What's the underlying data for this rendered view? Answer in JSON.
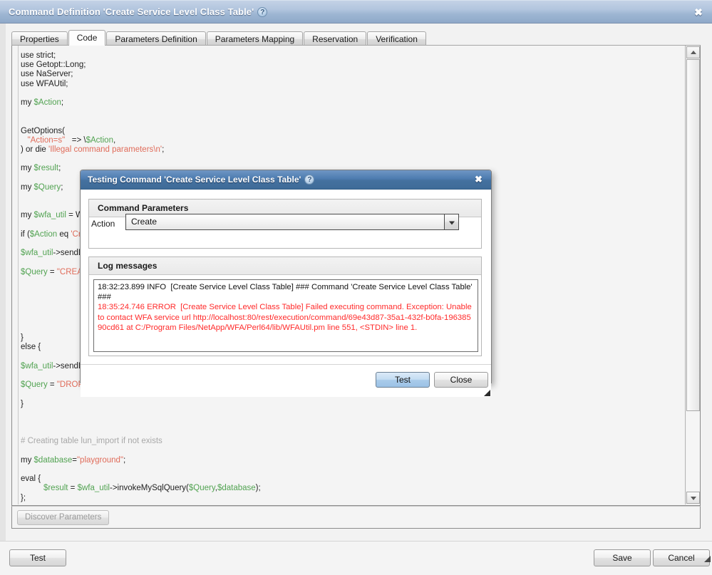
{
  "window": {
    "title": "Command Definition 'Create Service Level Class Table'",
    "help_icon_label": "?",
    "close_label": "✖"
  },
  "tabs": [
    {
      "label": "Properties",
      "active": false
    },
    {
      "label": "Code",
      "active": true
    },
    {
      "label": "Parameters Definition",
      "active": false
    },
    {
      "label": "Parameters Mapping",
      "active": false
    },
    {
      "label": "Reservation",
      "active": false
    },
    {
      "label": "Verification",
      "active": false
    }
  ],
  "code_editor": {
    "lines": [
      [
        {
          "t": "use strict;",
          "c": "pln"
        }
      ],
      [
        {
          "t": "use Getopt::Long;",
          "c": "pln"
        }
      ],
      [
        {
          "t": "use NaServer;",
          "c": "pln"
        }
      ],
      [
        {
          "t": "use WFAUtil;",
          "c": "pln"
        }
      ],
      [
        {
          "t": "",
          "c": "pln"
        }
      ],
      [
        {
          "t": "my ",
          "c": "pln"
        },
        {
          "t": "$Action",
          "c": "var"
        },
        {
          "t": ";",
          "c": "pln"
        }
      ],
      [
        {
          "t": "",
          "c": "pln"
        }
      ],
      [
        {
          "t": "",
          "c": "pln"
        }
      ],
      [
        {
          "t": "GetOptions(",
          "c": "pln"
        }
      ],
      [
        {
          "t": "   ",
          "c": "pln"
        },
        {
          "t": "\"Action=s\"",
          "c": "str"
        },
        {
          "t": "   => \\",
          "c": "pln"
        },
        {
          "t": "$Action",
          "c": "var"
        },
        {
          "t": ",",
          "c": "pln"
        }
      ],
      [
        {
          "t": ") or die ",
          "c": "pln"
        },
        {
          "t": "'Illegal command parameters\\n'",
          "c": "str"
        },
        {
          "t": ";",
          "c": "pln"
        }
      ],
      [
        {
          "t": "",
          "c": "pln"
        }
      ],
      [
        {
          "t": "my ",
          "c": "pln"
        },
        {
          "t": "$result",
          "c": "var"
        },
        {
          "t": ";",
          "c": "pln"
        }
      ],
      [
        {
          "t": "",
          "c": "pln"
        }
      ],
      [
        {
          "t": "my ",
          "c": "pln"
        },
        {
          "t": "$Query",
          "c": "var"
        },
        {
          "t": ";",
          "c": "pln"
        }
      ],
      [
        {
          "t": "",
          "c": "pln"
        }
      ],
      [
        {
          "t": "",
          "c": "pln"
        }
      ],
      [
        {
          "t": "my ",
          "c": "pln"
        },
        {
          "t": "$wfa_util",
          "c": "var"
        },
        {
          "t": " = W",
          "c": "pln"
        }
      ],
      [
        {
          "t": "",
          "c": "pln"
        }
      ],
      [
        {
          "t": "if (",
          "c": "pln"
        },
        {
          "t": "$Action",
          "c": "var"
        },
        {
          "t": " eq ",
          "c": "pln"
        },
        {
          "t": "'Cre",
          "c": "str"
        }
      ],
      [
        {
          "t": "",
          "c": "pln"
        }
      ],
      [
        {
          "t": "$wfa_util",
          "c": "var"
        },
        {
          "t": "->sendL",
          "c": "pln"
        }
      ],
      [
        {
          "t": "",
          "c": "pln"
        }
      ],
      [
        {
          "t": "$Query",
          "c": "var"
        },
        {
          "t": " = ",
          "c": "pln"
        },
        {
          "t": "\"CREAT",
          "c": "str"
        }
      ],
      [
        {
          "t": "",
          "c": "pln"
        }
      ],
      [
        {
          "t": "",
          "c": "pln"
        }
      ],
      [
        {
          "t": "",
          "c": "pln"
        }
      ],
      [
        {
          "t": "",
          "c": "pln"
        }
      ],
      [
        {
          "t": "",
          "c": "pln"
        }
      ],
      [
        {
          "t": "",
          "c": "pln"
        }
      ],
      [
        {
          "t": "}",
          "c": "pln"
        }
      ],
      [
        {
          "t": "else {",
          "c": "pln"
        }
      ],
      [
        {
          "t": "",
          "c": "pln"
        }
      ],
      [
        {
          "t": "$wfa_util",
          "c": "var"
        },
        {
          "t": "->sendL",
          "c": "pln"
        }
      ],
      [
        {
          "t": "",
          "c": "pln"
        }
      ],
      [
        {
          "t": "$Query",
          "c": "var"
        },
        {
          "t": " = ",
          "c": "pln"
        },
        {
          "t": "\"DROP TABLE playground.service_level_class\"",
          "c": "str"
        },
        {
          "t": ";",
          "c": "pln"
        }
      ],
      [
        {
          "t": "",
          "c": "pln"
        }
      ],
      [
        {
          "t": "}",
          "c": "pln"
        }
      ],
      [
        {
          "t": "",
          "c": "pln"
        }
      ],
      [
        {
          "t": "",
          "c": "pln"
        }
      ],
      [
        {
          "t": "",
          "c": "pln"
        }
      ],
      [
        {
          "t": "# Creating table lun_import if not exists",
          "c": "cmt"
        }
      ],
      [
        {
          "t": "",
          "c": "pln"
        }
      ],
      [
        {
          "t": "my ",
          "c": "pln"
        },
        {
          "t": "$database",
          "c": "var"
        },
        {
          "t": "=",
          "c": "pln"
        },
        {
          "t": "\"playground\"",
          "c": "str"
        },
        {
          "t": ";",
          "c": "pln"
        }
      ],
      [
        {
          "t": "",
          "c": "pln"
        }
      ],
      [
        {
          "t": "eval {",
          "c": "pln"
        }
      ],
      [
        {
          "t": "          ",
          "c": "pln"
        },
        {
          "t": "$result",
          "c": "var"
        },
        {
          "t": " = ",
          "c": "pln"
        },
        {
          "t": "$wfa_util",
          "c": "var"
        },
        {
          "t": "->invokeMySqlQuery(",
          "c": "pln"
        },
        {
          "t": "$Query",
          "c": "var"
        },
        {
          "t": ",",
          "c": "pln"
        },
        {
          "t": "$database",
          "c": "var"
        },
        {
          "t": ");",
          "c": "pln"
        }
      ],
      [
        {
          "t": "};",
          "c": "pln"
        }
      ]
    ]
  },
  "code_toolbar": {
    "discover_parameters_label": "Discover Parameters"
  },
  "bottom_bar": {
    "test_label": "Test",
    "save_label": "Save",
    "cancel_label": "Cancel"
  },
  "dialog": {
    "title": "Testing Command 'Create Service Level Class Table'",
    "help_icon_label": "?",
    "close_label": "✖",
    "command_parameters": {
      "group_title": "Command Parameters",
      "action_label": "Action",
      "action_value": "Create"
    },
    "log_messages": {
      "group_title": "Log messages",
      "entries": [
        {
          "level": "INFO",
          "text": "18:32:23.899 INFO  [Create Service Level Class Table] ### Command 'Create Service Level Class Table' ###",
          "is_error": false
        },
        {
          "level": "ERROR",
          "text": "18:35:24.746 ERROR  [Create Service Level Class Table] Failed executing command. Exception: Unable to contact WFA service url http://localhost:80/rest/execution/command/69e43d87-35a1-432f-b0fa-19638590cd61 at C:/Program Files/NetApp/WFA/Perl64/lib/WFAUtil.pm line 551, <STDIN> line 1.",
          "is_error": true
        }
      ]
    },
    "footer": {
      "test_label": "Test",
      "close_label": "Close"
    }
  },
  "colors": {
    "window_titlebar": "#9eb6d3",
    "dialog_titlebar": "#4d7cb0",
    "error_text": "#ff2a2a",
    "code_string": "#e06c5a",
    "code_variable": "#52a352",
    "code_comment": "#a8a8a8",
    "primary_button": "#a9cbea"
  }
}
